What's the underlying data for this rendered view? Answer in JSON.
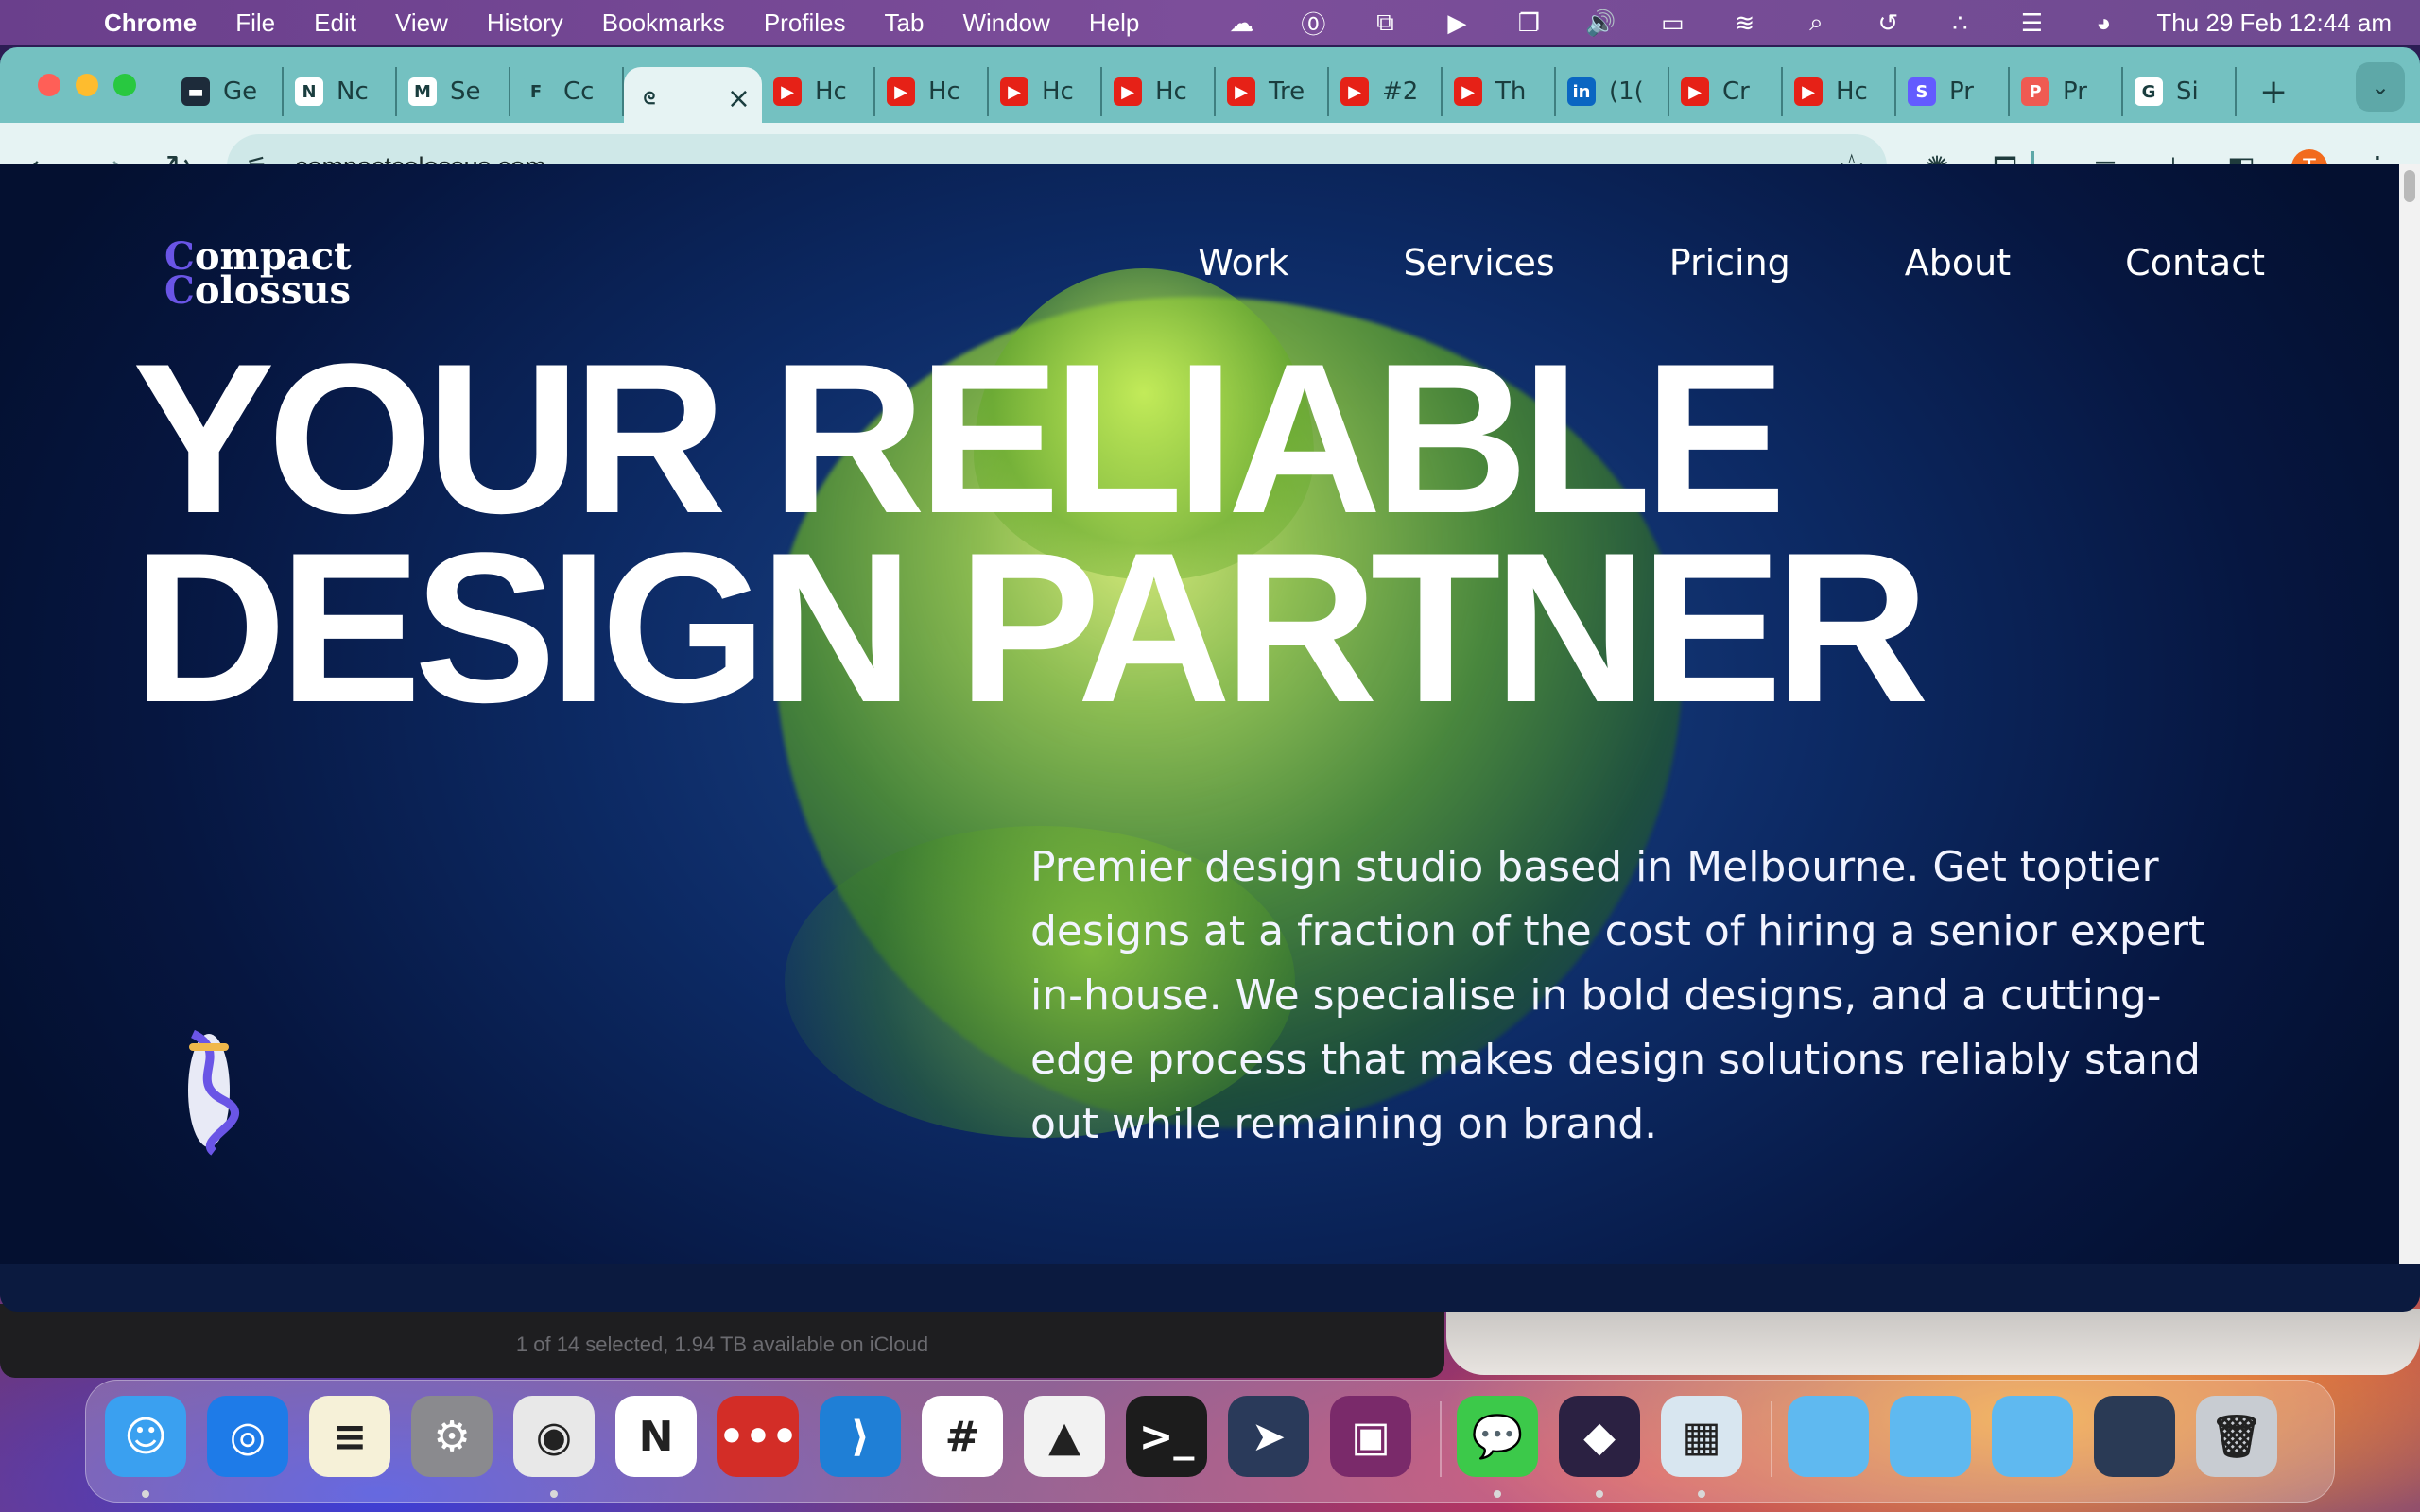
{
  "menubar": {
    "app": "Chrome",
    "menus": [
      "File",
      "Edit",
      "View",
      "History",
      "Bookmarks",
      "Profiles",
      "Tab",
      "Window",
      "Help"
    ],
    "clock": "Thu 29 Feb  12:44 am"
  },
  "tabs": [
    {
      "label": "Ge",
      "fav": "▬",
      "color": "#1d2b3a"
    },
    {
      "label": "Nc",
      "fav": "N",
      "color": "#ffffff"
    },
    {
      "label": "Se",
      "fav": "M",
      "color": "#ffffff"
    },
    {
      "label": "Cc",
      "fav": "F",
      "color": "#74c1c1"
    },
    {
      "label": "",
      "fav": "ᘓ",
      "color": "#e6f3f3",
      "active": true
    },
    {
      "label": "Hc",
      "fav": "▶",
      "color": "#e62117"
    },
    {
      "label": "Hc",
      "fav": "▶",
      "color": "#e62117"
    },
    {
      "label": "Hc",
      "fav": "▶",
      "color": "#e62117"
    },
    {
      "label": "Hc",
      "fav": "▶",
      "color": "#e62117"
    },
    {
      "label": "Tre",
      "fav": "▶",
      "color": "#e62117"
    },
    {
      "label": "#2",
      "fav": "▶",
      "color": "#e62117"
    },
    {
      "label": "Th",
      "fav": "▶",
      "color": "#e62117"
    },
    {
      "label": "(1(",
      "fav": "in",
      "color": "#0a66c2"
    },
    {
      "label": "Cr",
      "fav": "▶",
      "color": "#e62117"
    },
    {
      "label": "Hc",
      "fav": "▶",
      "color": "#e62117"
    },
    {
      "label": "Pr",
      "fav": "S",
      "color": "#635bff"
    },
    {
      "label": "Pr",
      "fav": "P",
      "color": "#ef5a52"
    },
    {
      "label": "Si",
      "fav": "G",
      "color": "#ffffff"
    }
  ],
  "toolbar": {
    "url": "compactcolossus.com",
    "profile_initial": "T"
  },
  "site": {
    "logo_line1": "ompact",
    "logo_line2": "olossus",
    "logo_cap": "C",
    "nav": [
      "Work",
      "Services",
      "Pricing",
      "About",
      "Contact"
    ],
    "headline_1": "YOUR RELIABLE",
    "headline_2": "DESIGN PARTNER",
    "tagline": "Premier design studio based in Melbourne. Get toptier designs at a fraction of the cost of hiring a senior expert in-house. We specialise in bold designs, and a cutting-edge process that makes design solutions reliably stand out while remaining on brand."
  },
  "background_window": {
    "status": "1 of 14 selected, 1.94 TB available on iCloud"
  },
  "dock": [
    {
      "name": "finder",
      "glyph": "☺",
      "color": "#3aa0f0"
    },
    {
      "name": "safari",
      "glyph": "◎",
      "color": "#1e7be8"
    },
    {
      "name": "notes",
      "glyph": "≡",
      "color": "#f6f1d8"
    },
    {
      "name": "system-settings",
      "glyph": "⚙",
      "color": "#8a8a8e"
    },
    {
      "name": "chrome",
      "glyph": "◉",
      "color": "#e8e8e8"
    },
    {
      "name": "notion",
      "glyph": "N",
      "color": "#ffffff"
    },
    {
      "name": "lastpass",
      "glyph": "•••",
      "color": "#d32d27"
    },
    {
      "name": "vscode",
      "glyph": "⟩",
      "color": "#1f7fd6"
    },
    {
      "name": "slack",
      "glyph": "#",
      "color": "#ffffff"
    },
    {
      "name": "google-drive",
      "glyph": "▲",
      "color": "#f2f2f2"
    },
    {
      "name": "terminal",
      "glyph": ">_",
      "color": "#1c1c1c"
    },
    {
      "name": "send-app",
      "glyph": "➤",
      "color": "#2a3a5a"
    },
    {
      "name": "screen-app",
      "glyph": "▣",
      "color": "#7a2a6a"
    },
    {
      "name": "messages",
      "glyph": "💬",
      "color": "#3cc94a"
    },
    {
      "name": "obsidian",
      "glyph": "◆",
      "color": "#2b2142"
    },
    {
      "name": "preview",
      "glyph": "▦",
      "color": "#d8e6f0"
    },
    {
      "name": "folder-1",
      "glyph": "",
      "color": "#5fb9f0"
    },
    {
      "name": "folder-2",
      "glyph": "",
      "color": "#5fb9f0"
    },
    {
      "name": "folder-3",
      "glyph": "",
      "color": "#5fb9f0"
    },
    {
      "name": "downloads-stack",
      "glyph": "",
      "color": "#2a3a55"
    },
    {
      "name": "trash",
      "glyph": "🗑",
      "color": "#c8ccd2"
    }
  ]
}
